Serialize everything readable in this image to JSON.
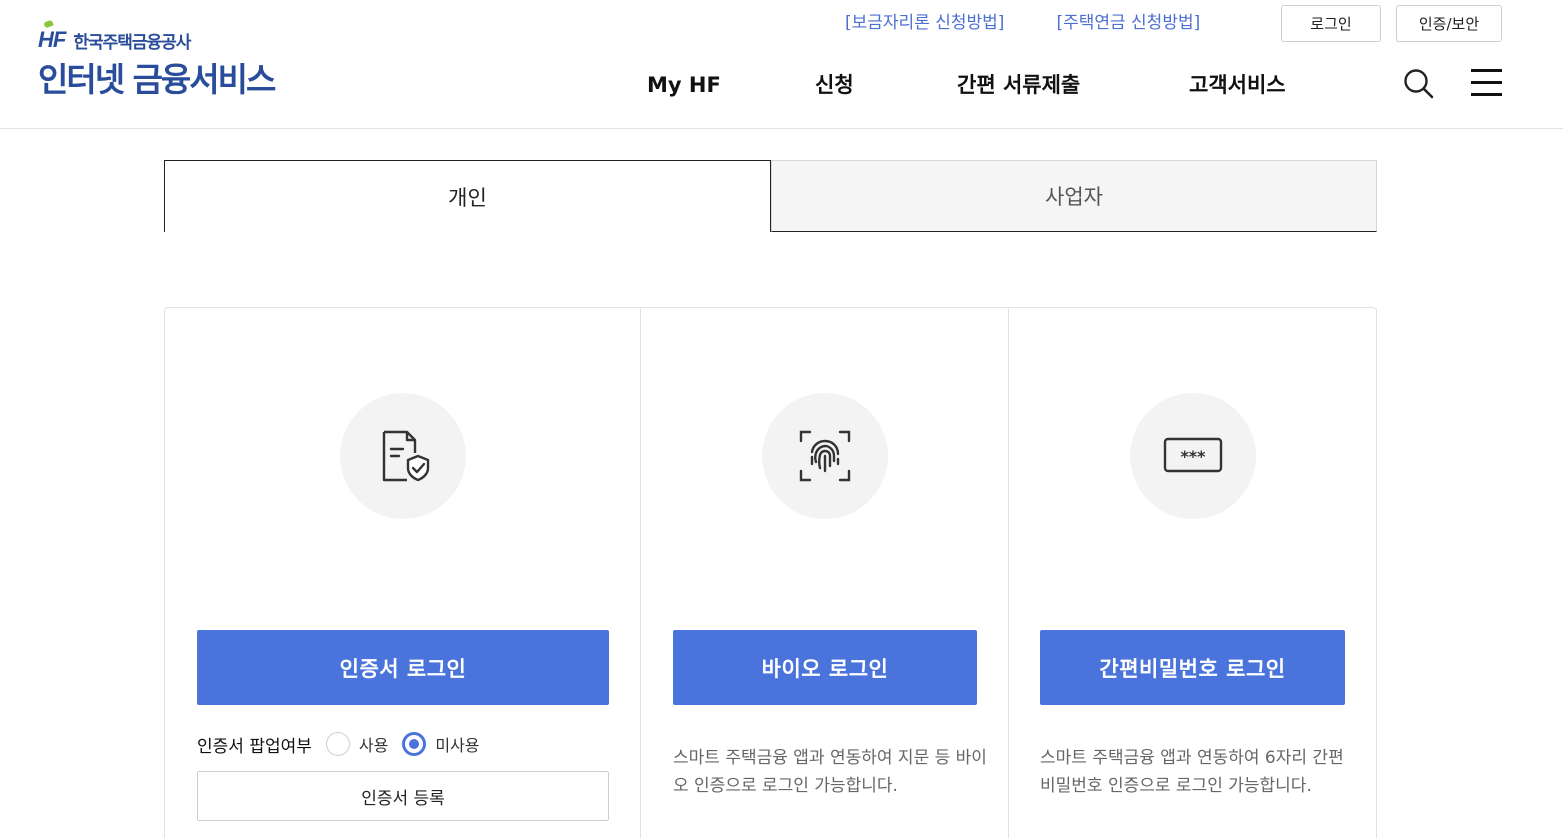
{
  "header": {
    "org_mark": "HF",
    "org_name": "한국주택금융공사",
    "service_title": "인터넷 금융서비스",
    "util_links": [
      "[보금자리론 신청방법]",
      "[주택연금 신청방법]"
    ],
    "login_button": "로그인",
    "security_button": "인증/보안",
    "nav": [
      "My HF",
      "신청",
      "간편 서류제출",
      "고객서비스"
    ],
    "icons": {
      "search": "search-icon",
      "menu": "hamburger-menu-icon"
    }
  },
  "tabs": [
    {
      "label": "개인",
      "active": true
    },
    {
      "label": "사업자",
      "active": false
    }
  ],
  "login_methods": {
    "certificate": {
      "icon": "certificate-document-shield-icon",
      "button_label": "인증서 로그인",
      "popup_label": "인증서 팝업여부",
      "options": [
        {
          "label": "사용",
          "checked": false
        },
        {
          "label": "미사용",
          "checked": true
        }
      ],
      "register_button": "인증서 등록"
    },
    "bio": {
      "icon": "fingerprint-icon",
      "button_label": "바이오 로그인",
      "description": "스마트 주택금융 앱과 연동하여 지문 등 바이오 인증으로 로그인 가능합니다."
    },
    "pin": {
      "icon": "password-field-icon",
      "button_label": "간편비밀번호 로그인",
      "description": "스마트 주택금융 앱과 연동하여 6자리 간편비밀번호 인증으로 로그인 가능합니다."
    }
  },
  "colors": {
    "brand_navy": "#2a4d9b",
    "brand_green": "#8cc63f",
    "link_blue": "#4d6fd2",
    "primary_button": "#4a74dc"
  }
}
